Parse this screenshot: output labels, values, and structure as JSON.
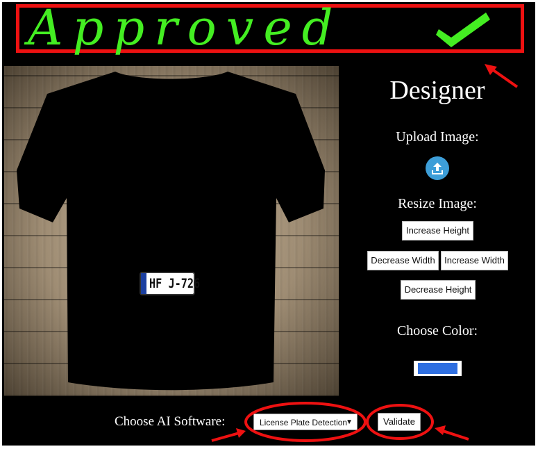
{
  "banner": {
    "text": "Approved",
    "check_icon": "checkmark-icon",
    "color": "#44ee22"
  },
  "designer": {
    "title": "Designer",
    "upload_label": "Upload Image:",
    "upload_icon": "upload-icon",
    "resize_label": "Resize Image:",
    "buttons": {
      "increase_height": "Increase Height",
      "decrease_width": "Decrease Width",
      "increase_width": "Increase Width",
      "decrease_height": "Decrease Height"
    },
    "color_label": "Choose Color:",
    "color_value": "#2f6fe0"
  },
  "shirt": {
    "color": "#000000",
    "plate_text": "HF J-726"
  },
  "ai": {
    "label": "Choose AI Software:",
    "selected": "License Plate Detection",
    "validate_label": "Validate"
  },
  "annotations": {
    "color": "#ee1111"
  }
}
